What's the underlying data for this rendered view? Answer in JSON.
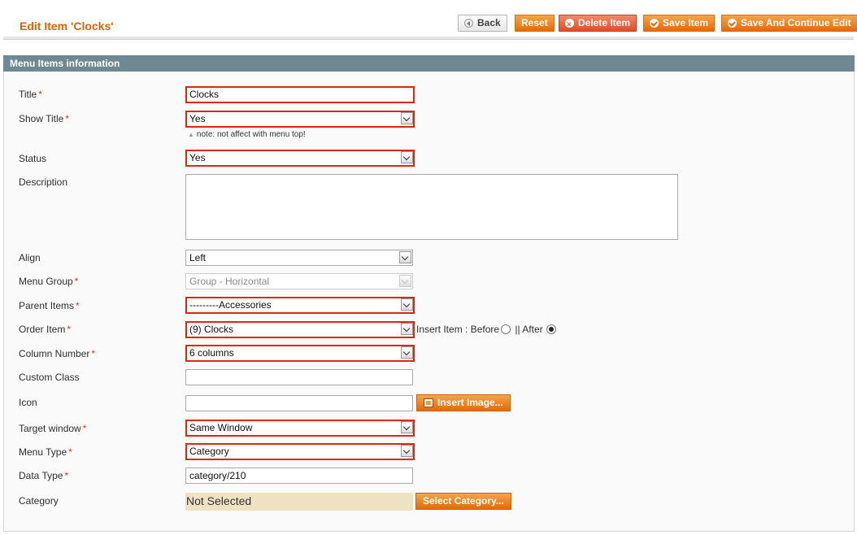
{
  "header": {
    "title": "Edit Item 'Clocks'",
    "buttons": {
      "back": "Back",
      "reset": "Reset",
      "delete": "Delete Item",
      "save": "Save Item",
      "save_continue": "Save And Continue Edit"
    }
  },
  "section": {
    "title": "Menu Items information"
  },
  "fields": {
    "title": {
      "label": "Title",
      "value": "Clocks"
    },
    "show_title": {
      "label": "Show Title",
      "value": "Yes",
      "note": "note: not affect with menu top!"
    },
    "status": {
      "label": "Status",
      "value": "Yes"
    },
    "description": {
      "label": "Description",
      "value": ""
    },
    "align": {
      "label": "Align",
      "value": "Left"
    },
    "menu_group": {
      "label": "Menu Group",
      "value": "Group - Horizontal"
    },
    "parent_items": {
      "label": "Parent Items",
      "value": "---------Accessories"
    },
    "order_item": {
      "label": "Order Item",
      "value": "(9) Clocks",
      "insert_label": "Insert Item : Before",
      "separator": " || After"
    },
    "column_number": {
      "label": "Column Number",
      "value": "6 columns"
    },
    "custom_class": {
      "label": "Custom Class",
      "value": ""
    },
    "icon": {
      "label": "Icon",
      "value": "",
      "button": "Insert Image..."
    },
    "target_window": {
      "label": "Target window",
      "value": "Same Window"
    },
    "menu_type": {
      "label": "Menu Type",
      "value": "Category"
    },
    "data_type": {
      "label": "Data Type",
      "value": "category/210"
    },
    "category": {
      "label": "Category",
      "value": "Not Selected",
      "button": "Select Category..."
    }
  },
  "required_mark": "*",
  "colors": {
    "accent": "#eb5e00",
    "section_header": "#6f8992",
    "error_border": "#df280a",
    "required": "#eb340a"
  }
}
